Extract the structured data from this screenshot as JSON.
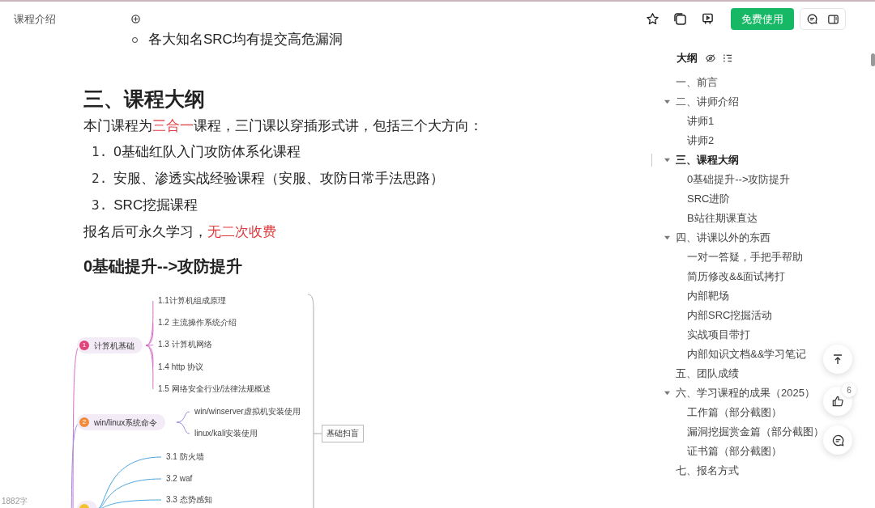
{
  "header": {
    "title": "课程介绍",
    "cta": "免费使用"
  },
  "doc": {
    "cut_line": "各大知名SRC均有提交高危漏洞",
    "heading": "三、课程大纲",
    "intro": [
      {
        "text": "本门课程为",
        "highlight": false
      },
      {
        "text": "三合一",
        "highlight": true
      },
      {
        "text": "课程，三门课以穿插形式讲，包括三个大方向：",
        "highlight": false
      }
    ],
    "list": [
      {
        "marker": "1.",
        "text": "0基础红队入门攻防体系化课程"
      },
      {
        "marker": "2.",
        "text": "安服、渗透实战经验课程（安服、攻防日常手法思路）"
      },
      {
        "marker": "3.",
        "text": "SRC挖掘课程"
      }
    ],
    "note": [
      {
        "text": "报名后可永久学习，",
        "highlight": false
      },
      {
        "text": "无二次收费",
        "highlight": true
      }
    ],
    "subheading": "0基础提升-->攻防提升",
    "word_count": "1882字"
  },
  "mindmap": {
    "branches": [
      {
        "label": "计算机基础",
        "badge": "1",
        "color": "#e0457b",
        "children": [
          "1.1计算机组成原理",
          "1.2 主流操作系统介绍",
          "1.3 计算机网络",
          "1.4 http 协议",
          "1.5 网络安全行业/法律法规概述"
        ]
      },
      {
        "label": "win/linux系统命令",
        "badge": "2",
        "color": "#f08a3c",
        "children": [
          "win/winserver虚拟机安装使用",
          "linux/kali安装使用"
        ]
      },
      {
        "color": "#f2c230",
        "children": [
          "3.1 防火墙",
          "3.2 waf",
          "3.3 态势感知"
        ]
      }
    ],
    "group_label": "基础扫盲"
  },
  "outline": {
    "title": "大纲",
    "items": [
      {
        "label": "一、前言",
        "selected": false
      },
      {
        "label": "二、讲师介绍",
        "selected": false,
        "expanded": true,
        "children": [
          {
            "label": "讲师1",
            "selected": false
          },
          {
            "label": "讲师2",
            "selected": false
          }
        ]
      },
      {
        "label": "三、课程大纲",
        "selected": true,
        "expanded": true,
        "children": [
          {
            "label": "0基础提升-->攻防提升",
            "selected": false
          },
          {
            "label": "SRC进阶",
            "selected": false
          },
          {
            "label": "B站往期课直达",
            "selected": false
          }
        ]
      },
      {
        "label": "四、讲课以外的东西",
        "selected": false,
        "expanded": true,
        "children": [
          {
            "label": "一对一答疑，手把手帮助",
            "selected": false
          },
          {
            "label": "简历修改&&面试拷打",
            "selected": false
          },
          {
            "label": "内部靶场",
            "selected": false
          },
          {
            "label": "内部SRC挖掘活动",
            "selected": false
          },
          {
            "label": "实战项目带打",
            "selected": false
          },
          {
            "label": "内部知识文档&&学习笔记",
            "selected": false
          }
        ]
      },
      {
        "label": "五、团队成绩",
        "selected": false
      },
      {
        "label": "六、学习课程的成果（2025）",
        "selected": false,
        "expanded": true,
        "children": [
          {
            "label": "工作篇（部分截图）",
            "selected": false
          },
          {
            "label": "漏洞挖掘赏金篇（部分截图）",
            "selected": false
          },
          {
            "label": "证书篇（部分截图）",
            "selected": false
          }
        ]
      },
      {
        "label": "七、报名方式",
        "selected": false
      }
    ]
  },
  "float": {
    "like_count": "6"
  }
}
